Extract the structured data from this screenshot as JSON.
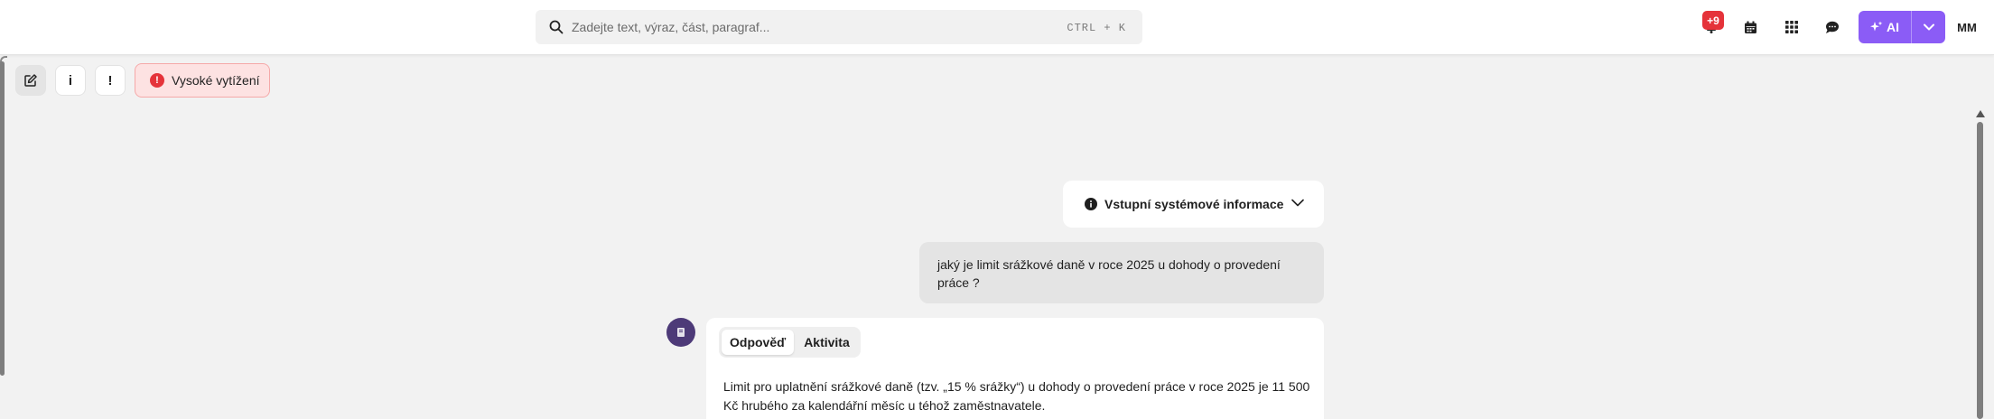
{
  "search": {
    "placeholder": "Zadejte text, výraz, část, paragraf...",
    "shortcut": "CTRL + K"
  },
  "header": {
    "notifications_badge": "+9",
    "icons": [
      "notification-icon",
      "calendar-icon",
      "apps-grid-icon",
      "chat-icon"
    ],
    "ai_label": "AI",
    "avatar_initials": "MM",
    "accent_color": "#8b5cf6"
  },
  "toolbar": {
    "edit_icon": "edit-icon",
    "info_label": "i",
    "alert_label": "!",
    "warning_label": "Vysoké vytížení"
  },
  "chat": {
    "system_info_label": "Vstupní systémové informace",
    "user_message": "jaký je limit srážkové daně v roce 2025 u dohody o provedení práce ?",
    "tabs": [
      "Odpověď",
      "Aktivita"
    ],
    "active_tab": "Odpověď",
    "answer_text": "Limit pro uplatnění srážkové daně (tzv. „15 % srážky“) u dohody o provedení práce v roce 2025 je 11 500 Kč hrubého za kalendářní měsíc u téhož zaměstnavatele."
  }
}
